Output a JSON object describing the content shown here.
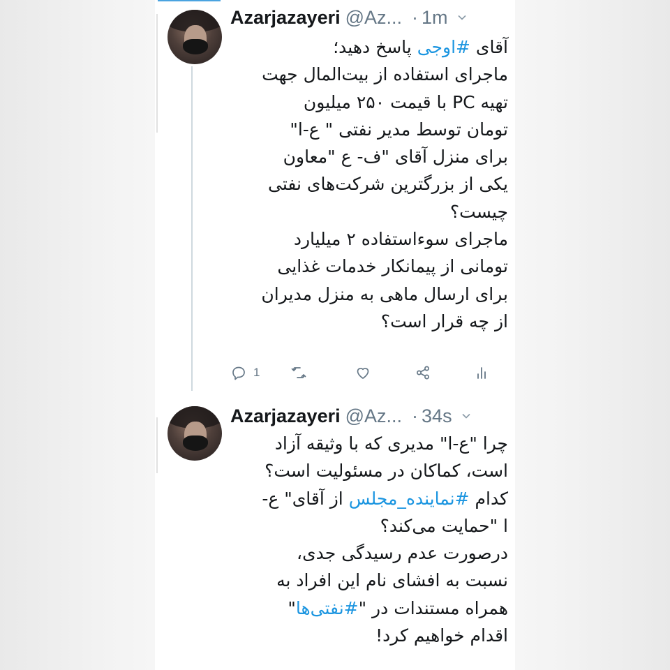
{
  "colors": {
    "link": "#1b95e0",
    "text": "#14171a",
    "muted": "#657786"
  },
  "tweets": [
    {
      "name": "Azarjazayeri",
      "handle": "@Az...",
      "time": "1m",
      "lines": [
        [
          "آقای ",
          "#اوجی",
          " پاسخ دهید؛"
        ],
        [
          "ماجرای استفاده از بیت‌المال جهت"
        ],
        [
          "تهیه PC با قیمت ۲۵۰ میلیون"
        ],
        [
          "تومان توسط مدیر نفتی \" ع-ا\""
        ],
        [
          "برای منزل آقای \"ف- ع \"معاون"
        ],
        [
          "یکی از بزرگترین شرکت‌های نفتی"
        ],
        [
          "چیست؟"
        ],
        [
          "ماجرای سوءاستفاده ۲ میلیارد"
        ],
        [
          "تومانی از پیمانکار خدمات غذایی"
        ],
        [
          "برای ارسال ماهی به منزل مدیران"
        ],
        [
          "از چه قرار است؟"
        ]
      ],
      "reply_count": "1",
      "icons": [
        "reply-icon",
        "retweet-icon",
        "like-icon",
        "share-icon",
        "analytics-icon"
      ]
    },
    {
      "name": "Azarjazayeri",
      "handle": "@Az...",
      "time": "34s",
      "lines": [
        [
          "چرا \"ع-ا\" مدیری که با وثیقه آزاد"
        ],
        [
          "است، کماکان در مسئولیت است؟"
        ],
        [
          "کدام ",
          "#نماینده_مجلس",
          " از آقای\" ع-"
        ],
        [
          "ا \"حمایت می‌کند؟"
        ],
        [
          "درصورت عدم رسیدگی جدی،"
        ],
        [
          "نسبت به  افشای نام این افراد به"
        ],
        [
          "همراه مستندات در \"",
          "#نفتی‌ها",
          "\""
        ],
        [
          "اقدام خواهیم کرد!"
        ]
      ]
    }
  ]
}
